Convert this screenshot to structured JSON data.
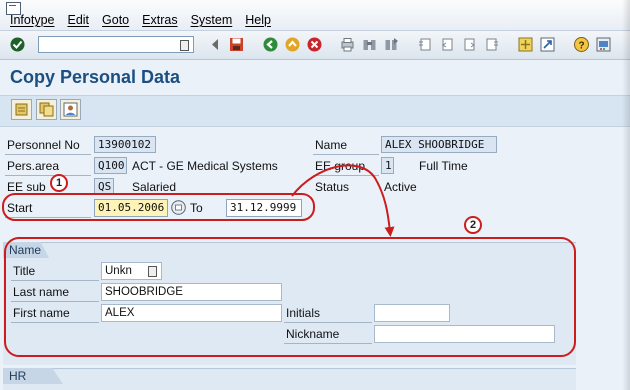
{
  "menu": [
    "Infotype",
    "Edit",
    "Goto",
    "Extras",
    "System",
    "Help"
  ],
  "toolbar": {
    "command_field_value": "",
    "icons": [
      "enter-icon",
      "command-dropdown-icon",
      "back-arrow-icon",
      "save-icon",
      "back-icon",
      "exit-icon",
      "cancel-icon",
      "print-icon",
      "find-icon",
      "find-next-icon",
      "first-page-icon",
      "previous-page-icon",
      "next-page-icon",
      "last-page-icon",
      "create-session-icon",
      "shortcut-icon",
      "help-icon",
      "customize-layout-icon"
    ]
  },
  "page": {
    "title": "Copy Personal Data"
  },
  "app_toolbar": {
    "icons": [
      "overview-icon",
      "copy-record-icon",
      "display-person-icon"
    ]
  },
  "header": {
    "personnel_no_label": "Personnel No",
    "personnel_no": "13900102",
    "name_label": "Name",
    "name_value": "ALEX SHOOBRIDGE",
    "pers_area_label": "Pers.area",
    "pers_area_code": "Q100",
    "pers_area_text": "ACT - GE Medical Systems",
    "ee_group_label": "EE group",
    "ee_group_code": "1",
    "ee_group_text": "Full Time",
    "ee_subgroup_label": "EE sub",
    "ee_subgroup_code": "QS",
    "ee_subgroup_text": "Salaried",
    "status_label": "Status",
    "status_text": "Active",
    "start_label": "Start",
    "start_value": "01.05.2006",
    "to_label": "To",
    "to_value": "31.12.9999"
  },
  "name_group": {
    "title": "Name",
    "title_label": "Title",
    "title_value": "Unkn",
    "last_name_label": "Last name",
    "last_name_value": "SHOOBRIDGE",
    "first_name_label": "First name",
    "first_name_value": "ALEX",
    "initials_label": "Initials",
    "initials_value": "",
    "nickname_label": "Nickname",
    "nickname_value": ""
  },
  "hr_group": {
    "title": "HR data"
  },
  "annotations": {
    "badge_1": "1",
    "badge_2": "2",
    "color": "#cc1d1d"
  }
}
